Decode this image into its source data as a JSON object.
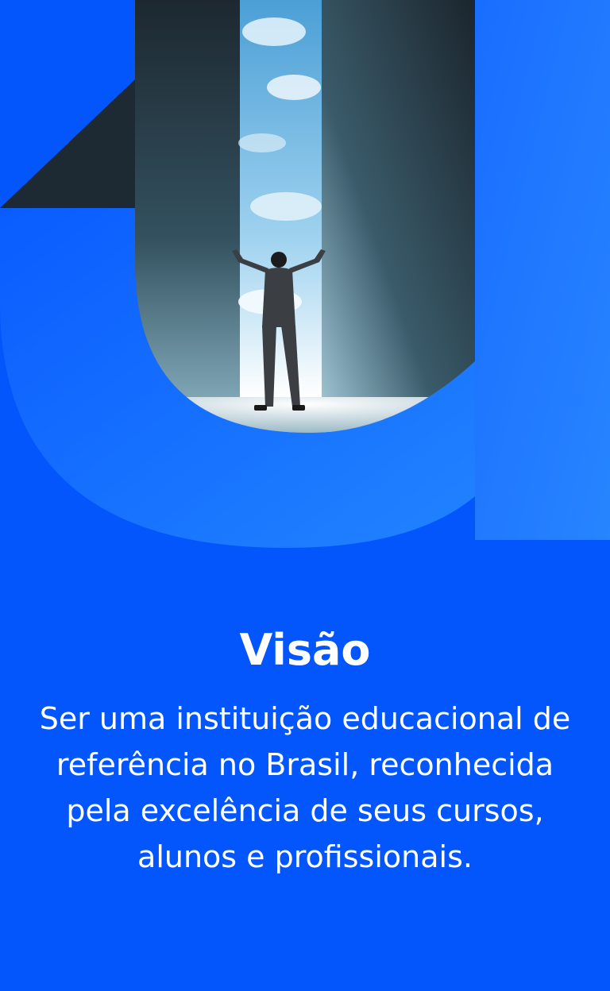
{
  "hero": {
    "subject": "businessman with raised arms facing an open doorway with sky",
    "brand_mark": "U letter shape"
  },
  "section": {
    "title": "Visão",
    "text": "Ser uma instituição educacional de referência no Brasil, reconhecida pela excelência de seus cursos, alunos e profissionais."
  },
  "colors": {
    "background": "#0356fb",
    "accent_light": "#1f7dff",
    "dark_wall": "#1e2a33",
    "text": "#ffffff"
  }
}
